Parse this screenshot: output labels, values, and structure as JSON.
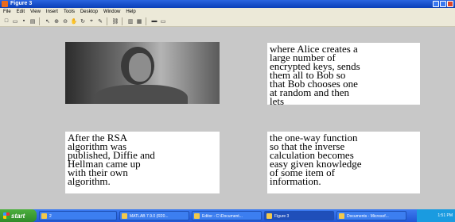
{
  "window": {
    "title": "Figure 3"
  },
  "menu": [
    "File",
    "Edit",
    "View",
    "Insert",
    "Tools",
    "Desktop",
    "Window",
    "Help"
  ],
  "toolbar_icons": [
    "new-icon",
    "open-icon",
    "save-icon",
    "print-icon",
    "pointer-icon",
    "zoom-in-icon",
    "zoom-out-icon",
    "pan-icon",
    "rotate-icon",
    "datacursor-icon",
    "brush-icon",
    "link-icon",
    "colorbar-icon",
    "legend-icon",
    "hide-plot-icon",
    "show-plot-icon"
  ],
  "textboxes": [
    "where Alice creates a\nlarge number of\nencrypted keys, sends\nthem all to Bob so\nthat Bob chooses one\nat random and then\nlets",
    "After the RSA\nalgorithm was\npublished, Diffie and\nHellman came up\nwith their own\nalgorithm.",
    "the one-way function\nso that the inverse\ncalculation becomes\neasy given knowledge\nof some item of\ninformation."
  ],
  "taskbar": {
    "start_label": "start",
    "tasks": [
      "2",
      "MATLAB 7.9.0 (R20...",
      "Editor - C:\\Document...",
      "Figure 3",
      "Documents - Microsof..."
    ],
    "tray_time": "1:51 PM"
  }
}
